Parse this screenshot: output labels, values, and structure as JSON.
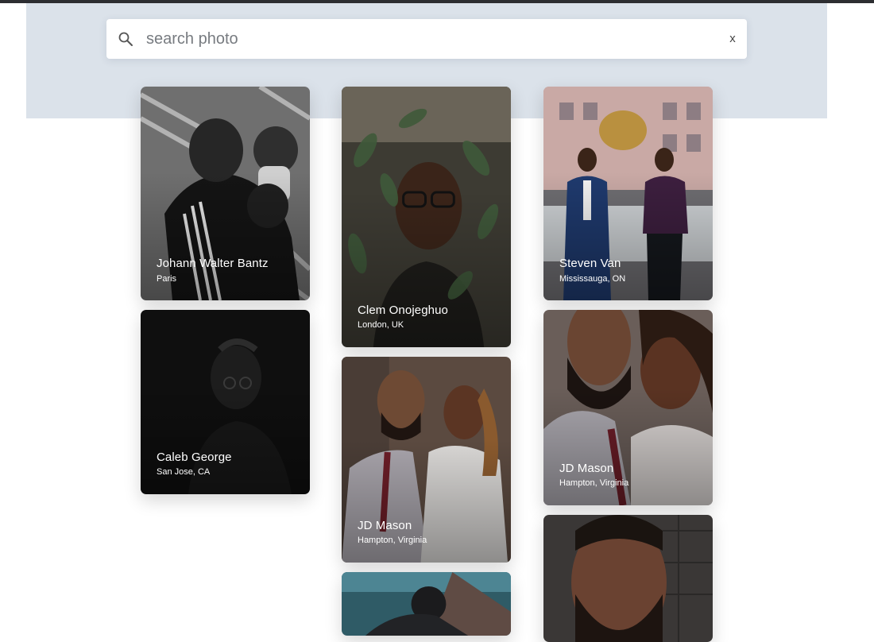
{
  "search": {
    "placeholder": "search photo",
    "clear_label": "x"
  },
  "colors": {
    "band": "#dbe2ea",
    "topline": "#2d2e31",
    "caption": "#ffffff"
  },
  "cards": [
    {
      "name": "Johann Walter Bantz",
      "location": "Paris",
      "icon": "boxer-photo"
    },
    {
      "name": "Caleb George",
      "location": "San Jose, CA",
      "icon": "dark-portrait-photo"
    },
    {
      "name": "Clem Onojeghuo",
      "location": "London, UK",
      "icon": "leaves-portrait-photo"
    },
    {
      "name": "JD Mason",
      "location": "Hampton, Virginia",
      "icon": "couple-photo"
    },
    {
      "name": "",
      "location": "",
      "icon": "partial-photo"
    },
    {
      "name": "Steven Van",
      "location": "Mississauga, ON",
      "icon": "two-men-street-photo"
    },
    {
      "name": "JD Mason",
      "location": "Hampton, Virginia",
      "icon": "couple-closeup-photo"
    },
    {
      "name": "",
      "location": "",
      "icon": "bearded-man-photo"
    }
  ]
}
